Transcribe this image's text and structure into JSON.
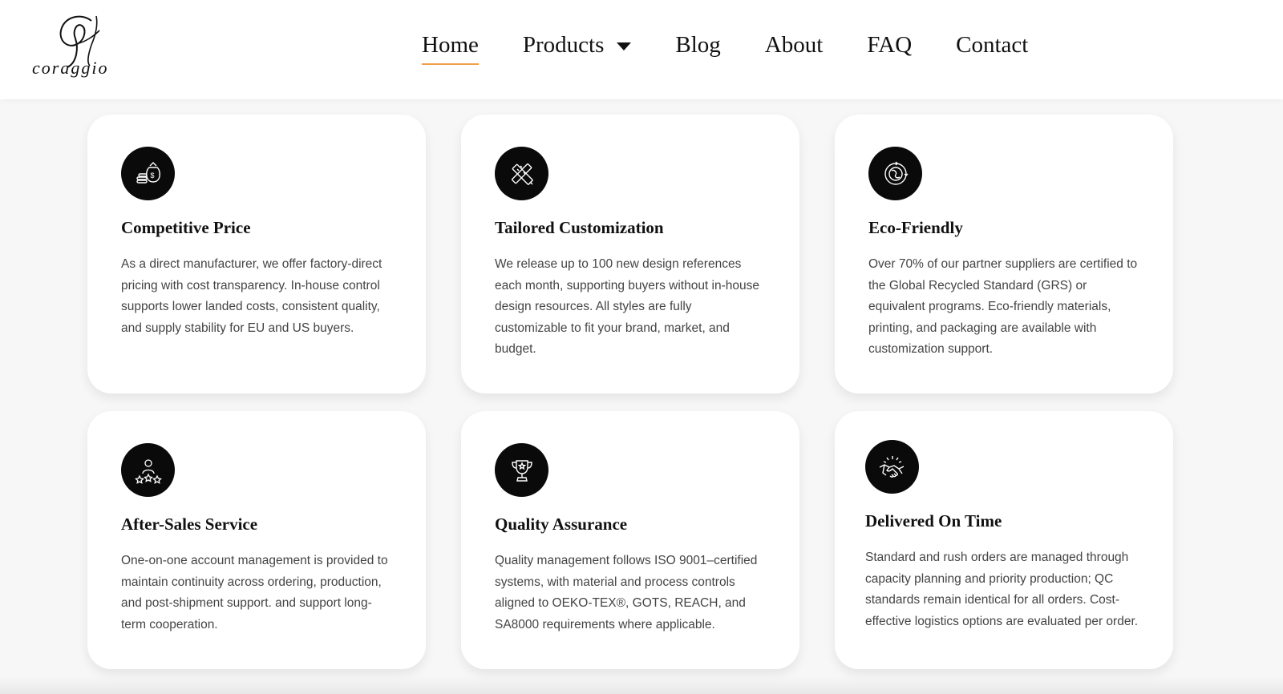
{
  "brand": {
    "logo_text": "coraggio",
    "logo_monogram": "G"
  },
  "nav": {
    "items": [
      {
        "label": "Home",
        "active": true
      },
      {
        "label": "Products",
        "has_dropdown": true
      },
      {
        "label": "Blog"
      },
      {
        "label": "About"
      },
      {
        "label": "FAQ"
      },
      {
        "label": "Contact"
      }
    ],
    "active_underline_color": "#f0a04b"
  },
  "features": [
    {
      "icon": "money-bag-coins-icon",
      "title": "Competitive Price",
      "description": "As a direct manufacturer, we offer factory-direct pricing with cost transparency. In-house control supports lower landed costs, consistent quality, and supply stability for EU and US buyers."
    },
    {
      "icon": "ruler-pencil-icon",
      "title": "Tailored Customization",
      "description": "We release up to 100 new design references each month, supporting buyers without in-house design resources. All styles are fully customizable to fit your brand, market, and budget."
    },
    {
      "icon": "eco-globe-icon",
      "title": "Eco-Friendly",
      "description": "Over 70% of our partner suppliers are certified to the Global Recycled Standard (GRS) or equivalent programs. Eco-friendly materials, printing, and packaging are available with customization support."
    },
    {
      "icon": "customer-stars-icon",
      "title": "After-Sales Service",
      "description": "One-on-one account management is provided to maintain continuity across ordering, production, and post-shipment support. and support long-term cooperation."
    },
    {
      "icon": "trophy-icon",
      "title": "Quality Assurance",
      "description": "Quality management follows ISO 9001–certified systems, with material and process controls aligned to OEKO-TEX®, GOTS, REACH, and SA8000 requirements where applicable."
    },
    {
      "icon": "handshake-icon",
      "title": "Delivered On Time",
      "description": "Standard and rush orders are managed through capacity planning and priority production; QC standards remain identical for all orders. Cost-effective logistics options are evaluated per order."
    }
  ]
}
